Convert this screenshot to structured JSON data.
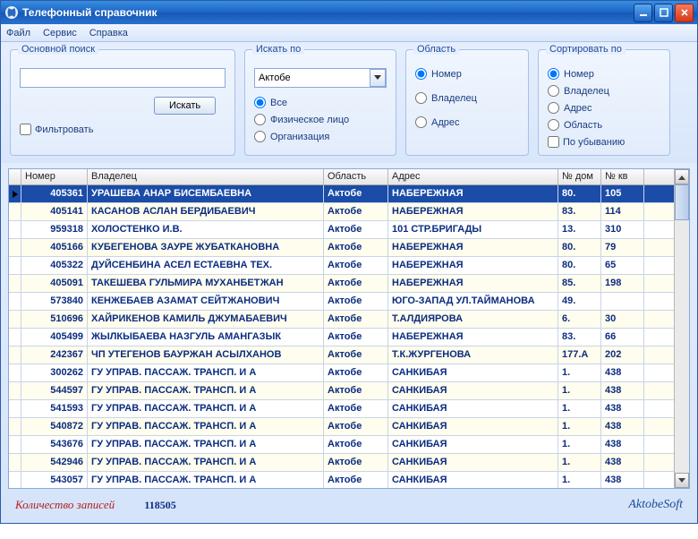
{
  "window": {
    "title": "Телефонный справочник"
  },
  "menu": {
    "file": "Файл",
    "service": "Сервис",
    "help": "Справка"
  },
  "search": {
    "group_title": "Основной поиск",
    "value": "",
    "button": "Искать",
    "filter_label": "Фильтровать"
  },
  "search_by": {
    "group_title": "Искать по",
    "select_value": "Актобе",
    "opt_all": "Все",
    "opt_person": "Физическое лицо",
    "opt_org": "Организация"
  },
  "region": {
    "group_title": "Область",
    "opt_number": "Номер",
    "opt_owner": "Владелец",
    "opt_address": "Адрес"
  },
  "sort": {
    "group_title": "Сортировать по",
    "opt_number": "Номер",
    "opt_owner": "Владелец",
    "opt_address": "Адрес",
    "opt_region": "Область",
    "desc_label": "По убыванию"
  },
  "columns": {
    "number": "Номер",
    "owner": "Владелец",
    "region": "Область",
    "address": "Адрес",
    "house": "№ дом",
    "apt": "№ кв"
  },
  "rows": [
    {
      "num": "405361",
      "own": "УРАШЕВА АНАР БИСЕМБАЕВНА",
      "reg": "Актобе",
      "adr": "НАБЕРЕЖНАЯ",
      "dom": "80.",
      "kv": "105"
    },
    {
      "num": "405141",
      "own": "КАСАНОВ АСЛАН БЕРДИБАЕВИЧ",
      "reg": "Актобе",
      "adr": "НАБЕРЕЖНАЯ",
      "dom": "83.",
      "kv": "114"
    },
    {
      "num": "959318",
      "own": "ХОЛОСТЕНКО И.В.",
      "reg": "Актобе",
      "adr": "101 СТР.БРИГАДЫ",
      "dom": "13.",
      "kv": "310"
    },
    {
      "num": "405166",
      "own": "КУБЕГЕНОВА ЗАУРЕ ЖУБАТКАНОВНА",
      "reg": "Актобе",
      "adr": "НАБЕРЕЖНАЯ",
      "dom": "80.",
      "kv": "79"
    },
    {
      "num": "405322",
      "own": "ДУЙСЕНБИНА АСЕЛ ЕСТАЕВНА ТЕХ.",
      "reg": "Актобе",
      "adr": "НАБЕРЕЖНАЯ",
      "dom": "80.",
      "kv": "65"
    },
    {
      "num": "405091",
      "own": "ТАКЕШЕВА ГУЛЬМИРА МУХАНБЕТЖАН",
      "reg": "Актобе",
      "adr": "НАБЕРЕЖНАЯ",
      "dom": "85.",
      "kv": "198"
    },
    {
      "num": "573840",
      "own": "КЕНЖЕБАЕВ АЗАМАТ СЕЙТЖАНОВИЧ",
      "reg": "Актобе",
      "adr": "ЮГО-ЗАПАД УЛ.ТАЙМАНОВА",
      "dom": "49.",
      "kv": ""
    },
    {
      "num": "510696",
      "own": "ХАЙРИКЕНОВ КАМИЛЬ ДЖУМАБАЕВИЧ",
      "reg": "Актобе",
      "adr": "Т.АЛДИЯРОВА",
      "dom": "6.",
      "kv": "30"
    },
    {
      "num": "405499",
      "own": "ЖЫЛКЫБАЕВА НАЗГУЛЬ АМАНГАЗЫК",
      "reg": "Актобе",
      "adr": "НАБЕРЕЖНАЯ",
      "dom": "83.",
      "kv": "66"
    },
    {
      "num": "242367",
      "own": "ЧП УТЕГЕНОВ БАУРЖАН АСЫЛХАНОВ",
      "reg": "Актобе",
      "adr": "Т.К.ЖУРГЕНОВА",
      "dom": "177.А",
      "kv": "202"
    },
    {
      "num": "300262",
      "own": "ГУ  УПРАВ. ПАССАЖ. ТРАНСП. И А",
      "reg": "Актобе",
      "adr": "САНКИБАЯ",
      "dom": "1.",
      "kv": "438"
    },
    {
      "num": "544597",
      "own": "ГУ  УПРАВ. ПАССАЖ. ТРАНСП. И А",
      "reg": "Актобе",
      "adr": "САНКИБАЯ",
      "dom": "1.",
      "kv": "438"
    },
    {
      "num": "541593",
      "own": "ГУ  УПРАВ. ПАССАЖ. ТРАНСП. И А",
      "reg": "Актобе",
      "adr": "САНКИБАЯ",
      "dom": "1.",
      "kv": "438"
    },
    {
      "num": "540872",
      "own": "ГУ  УПРАВ. ПАССАЖ. ТРАНСП. И А",
      "reg": "Актобе",
      "adr": "САНКИБАЯ",
      "dom": "1.",
      "kv": "438"
    },
    {
      "num": "543676",
      "own": "ГУ  УПРАВ. ПАССАЖ. ТРАНСП. И А",
      "reg": "Актобе",
      "adr": "САНКИБАЯ",
      "dom": "1.",
      "kv": "438"
    },
    {
      "num": "542946",
      "own": "ГУ  УПРАВ. ПАССАЖ. ТРАНСП. И А",
      "reg": "Актобе",
      "adr": "САНКИБАЯ",
      "dom": "1.",
      "kv": "438"
    },
    {
      "num": "543057",
      "own": "ГУ  УПРАВ. ПАССАЖ. ТРАНСП. И А",
      "reg": "Актобе",
      "adr": "САНКИБАЯ",
      "dom": "1.",
      "kv": "438"
    }
  ],
  "footer": {
    "record_label": "Количество записей",
    "record_count": "118505",
    "brand": "AktobeSoft"
  }
}
